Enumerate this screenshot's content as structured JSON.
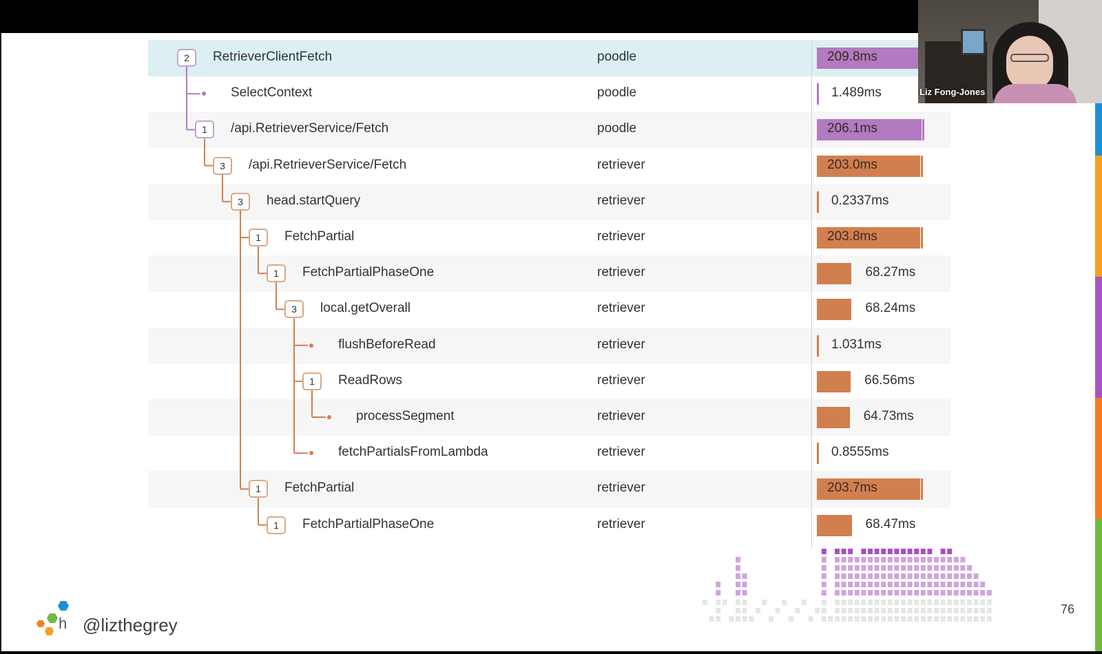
{
  "webcam": {
    "name": "Liz Fong-Jones"
  },
  "footer": {
    "handle": "@lizthegrey",
    "slide_number": "76",
    "logo_letter": "h"
  },
  "colors": {
    "poodle": "#b27ac0",
    "retriever": "#d27f4f",
    "selected_row": "#dceff3",
    "alt_row": "#f6f6f7"
  },
  "trace": {
    "rows": [
      {
        "name": "RetrieverClientFetch",
        "service": "poodle",
        "depth": 0,
        "children": "2",
        "duration": "209.8ms",
        "bar_fraction": 1.0,
        "selected": true
      },
      {
        "name": "SelectContext",
        "service": "poodle",
        "depth": 1,
        "children": "",
        "duration": "1.489ms",
        "bar_fraction": 0.007
      },
      {
        "name": "/api.RetrieverService/Fetch",
        "service": "poodle",
        "depth": 1,
        "children": "1",
        "duration": "206.1ms",
        "bar_fraction": 0.98
      },
      {
        "name": "/api.RetrieverService/Fetch",
        "service": "retriever",
        "depth": 2,
        "children": "3",
        "duration": "203.0ms",
        "bar_fraction": 0.97
      },
      {
        "name": "head.startQuery",
        "service": "retriever",
        "depth": 3,
        "children": "3",
        "duration": "0.2337ms",
        "bar_fraction": 0.001
      },
      {
        "name": "FetchPartial",
        "service": "retriever",
        "depth": 4,
        "children": "1",
        "duration": "203.8ms",
        "bar_fraction": 0.97
      },
      {
        "name": "FetchPartialPhaseOne",
        "service": "retriever",
        "depth": 5,
        "children": "1",
        "duration": "68.27ms",
        "bar_fraction": 0.325
      },
      {
        "name": "local.getOverall",
        "service": "retriever",
        "depth": 6,
        "children": "3",
        "duration": "68.24ms",
        "bar_fraction": 0.325
      },
      {
        "name": "flushBeforeRead",
        "service": "retriever",
        "depth": 7,
        "children": "",
        "duration": "1.031ms",
        "bar_fraction": 0.005
      },
      {
        "name": "ReadRows",
        "service": "retriever",
        "depth": 7,
        "children": "1",
        "duration": "66.56ms",
        "bar_fraction": 0.317
      },
      {
        "name": "processSegment",
        "service": "retriever",
        "depth": 8,
        "children": "",
        "duration": "64.73ms",
        "bar_fraction": 0.308
      },
      {
        "name": "fetchPartialsFromLambda",
        "service": "retriever",
        "depth": 7,
        "children": "",
        "duration": "0.8555ms",
        "bar_fraction": 0.004
      },
      {
        "name": "FetchPartial",
        "service": "retriever",
        "depth": 4,
        "children": "1",
        "duration": "203.7ms",
        "bar_fraction": 0.97
      },
      {
        "name": "FetchPartialPhaseOne",
        "service": "retriever",
        "depth": 5,
        "children": "1",
        "duration": "68.47ms",
        "bar_fraction": 0.326
      }
    ]
  }
}
